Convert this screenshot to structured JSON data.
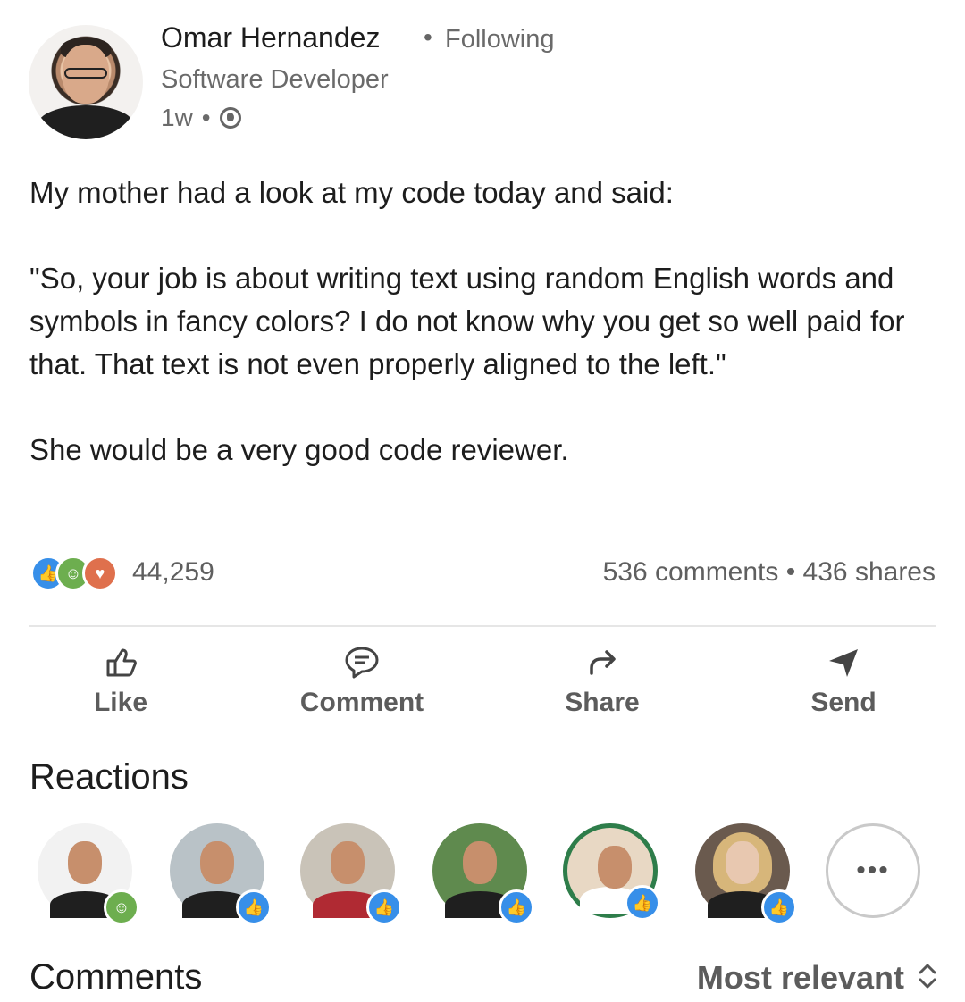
{
  "post": {
    "author": {
      "name": "Omar Hernandez",
      "separator": "•",
      "following": "Following",
      "headline": "Software Developer",
      "time": "1w",
      "time_separator": "•",
      "visibility_icon": "globe-icon"
    },
    "paragraphs": [
      "My mother had a look at my code today and said:",
      "\"So, your job is about writing text using random English words and symbols in fancy colors? I do not know why you get so well paid for that. That text is not even properly aligned to the left.\"",
      "She would be a very good code reviewer."
    ],
    "social": {
      "reaction_count": "44,259",
      "reaction_icons": [
        "like-icon",
        "celebrate-icon",
        "love-icon"
      ],
      "comments_shares": "536 comments • 436 shares"
    },
    "actions": [
      {
        "label": "Like",
        "icon": "thumbs-up-icon"
      },
      {
        "label": "Comment",
        "icon": "comment-icon"
      },
      {
        "label": "Share",
        "icon": "share-arrow-icon"
      },
      {
        "label": "Send",
        "icon": "send-icon"
      }
    ]
  },
  "reactions": {
    "title": "Reactions",
    "more": "•••",
    "badges": [
      "celebrate",
      "like",
      "like",
      "like",
      "like",
      "like"
    ]
  },
  "comments": {
    "title": "Comments",
    "sort_label": "Most relevant",
    "sort_icon": "sort-updown-icon"
  },
  "colors": {
    "like": "#378fe9",
    "celebrate": "#6dae4f",
    "love": "#df704d",
    "muted_text": "#666666"
  }
}
